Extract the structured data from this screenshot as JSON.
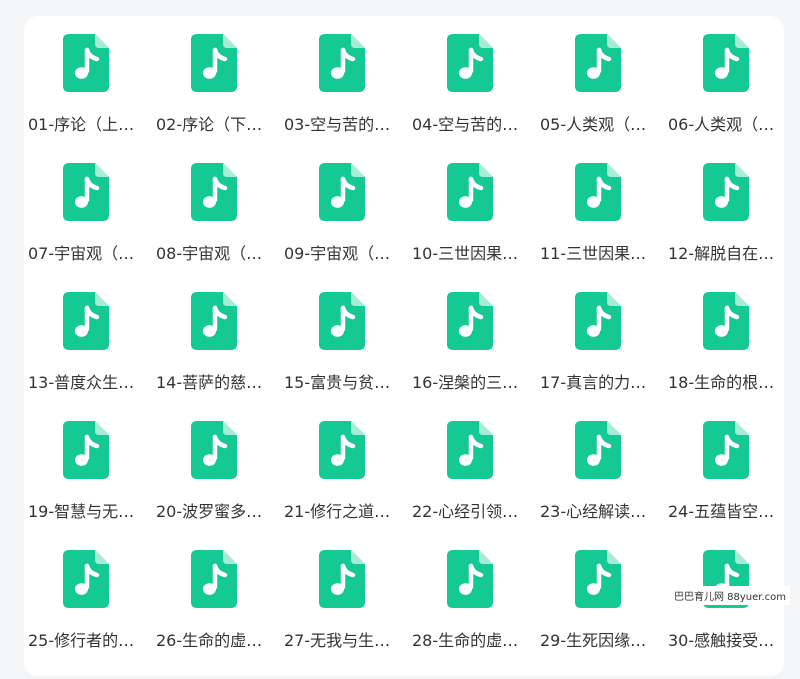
{
  "colors": {
    "icon_fill": "#15c994",
    "icon_fold": "#a6ecd7",
    "icon_note": "#ffffff",
    "label_text": "#333333",
    "background": "#f4f5f7",
    "panel": "#ffffff"
  },
  "file_icon": "audio-file-icon",
  "files": [
    {
      "label": "01-序论（上…"
    },
    {
      "label": "02-序论（下…"
    },
    {
      "label": "03-空与苦的…"
    },
    {
      "label": "04-空与苦的…"
    },
    {
      "label": "05-人类观（…"
    },
    {
      "label": "06-人类观（…"
    },
    {
      "label": "07-宇宙观（…"
    },
    {
      "label": "08-宇宙观（…"
    },
    {
      "label": "09-宇宙观（…"
    },
    {
      "label": "10-三世因果…"
    },
    {
      "label": "11-三世因果…"
    },
    {
      "label": "12-解脱自在…"
    },
    {
      "label": "13-普度众生…"
    },
    {
      "label": "14-菩萨的慈…"
    },
    {
      "label": "15-富贵与贫…"
    },
    {
      "label": "16-涅槃的三…"
    },
    {
      "label": "17-真言的力…"
    },
    {
      "label": "18-生命的根…"
    },
    {
      "label": "19-智慧与无…"
    },
    {
      "label": "20-波罗蜜多…"
    },
    {
      "label": "21-修行之道…"
    },
    {
      "label": "22-心经引领…"
    },
    {
      "label": "23-心经解读…"
    },
    {
      "label": "24-五蕴皆空…"
    },
    {
      "label": "25-修行者的…"
    },
    {
      "label": "26-生命的虚…"
    },
    {
      "label": "27-无我与生…"
    },
    {
      "label": "28-生命的虚…"
    },
    {
      "label": "29-生死因缘…"
    },
    {
      "label": "30-感触接受…"
    }
  ],
  "watermark": "巴巴育儿网 88yuer.com"
}
